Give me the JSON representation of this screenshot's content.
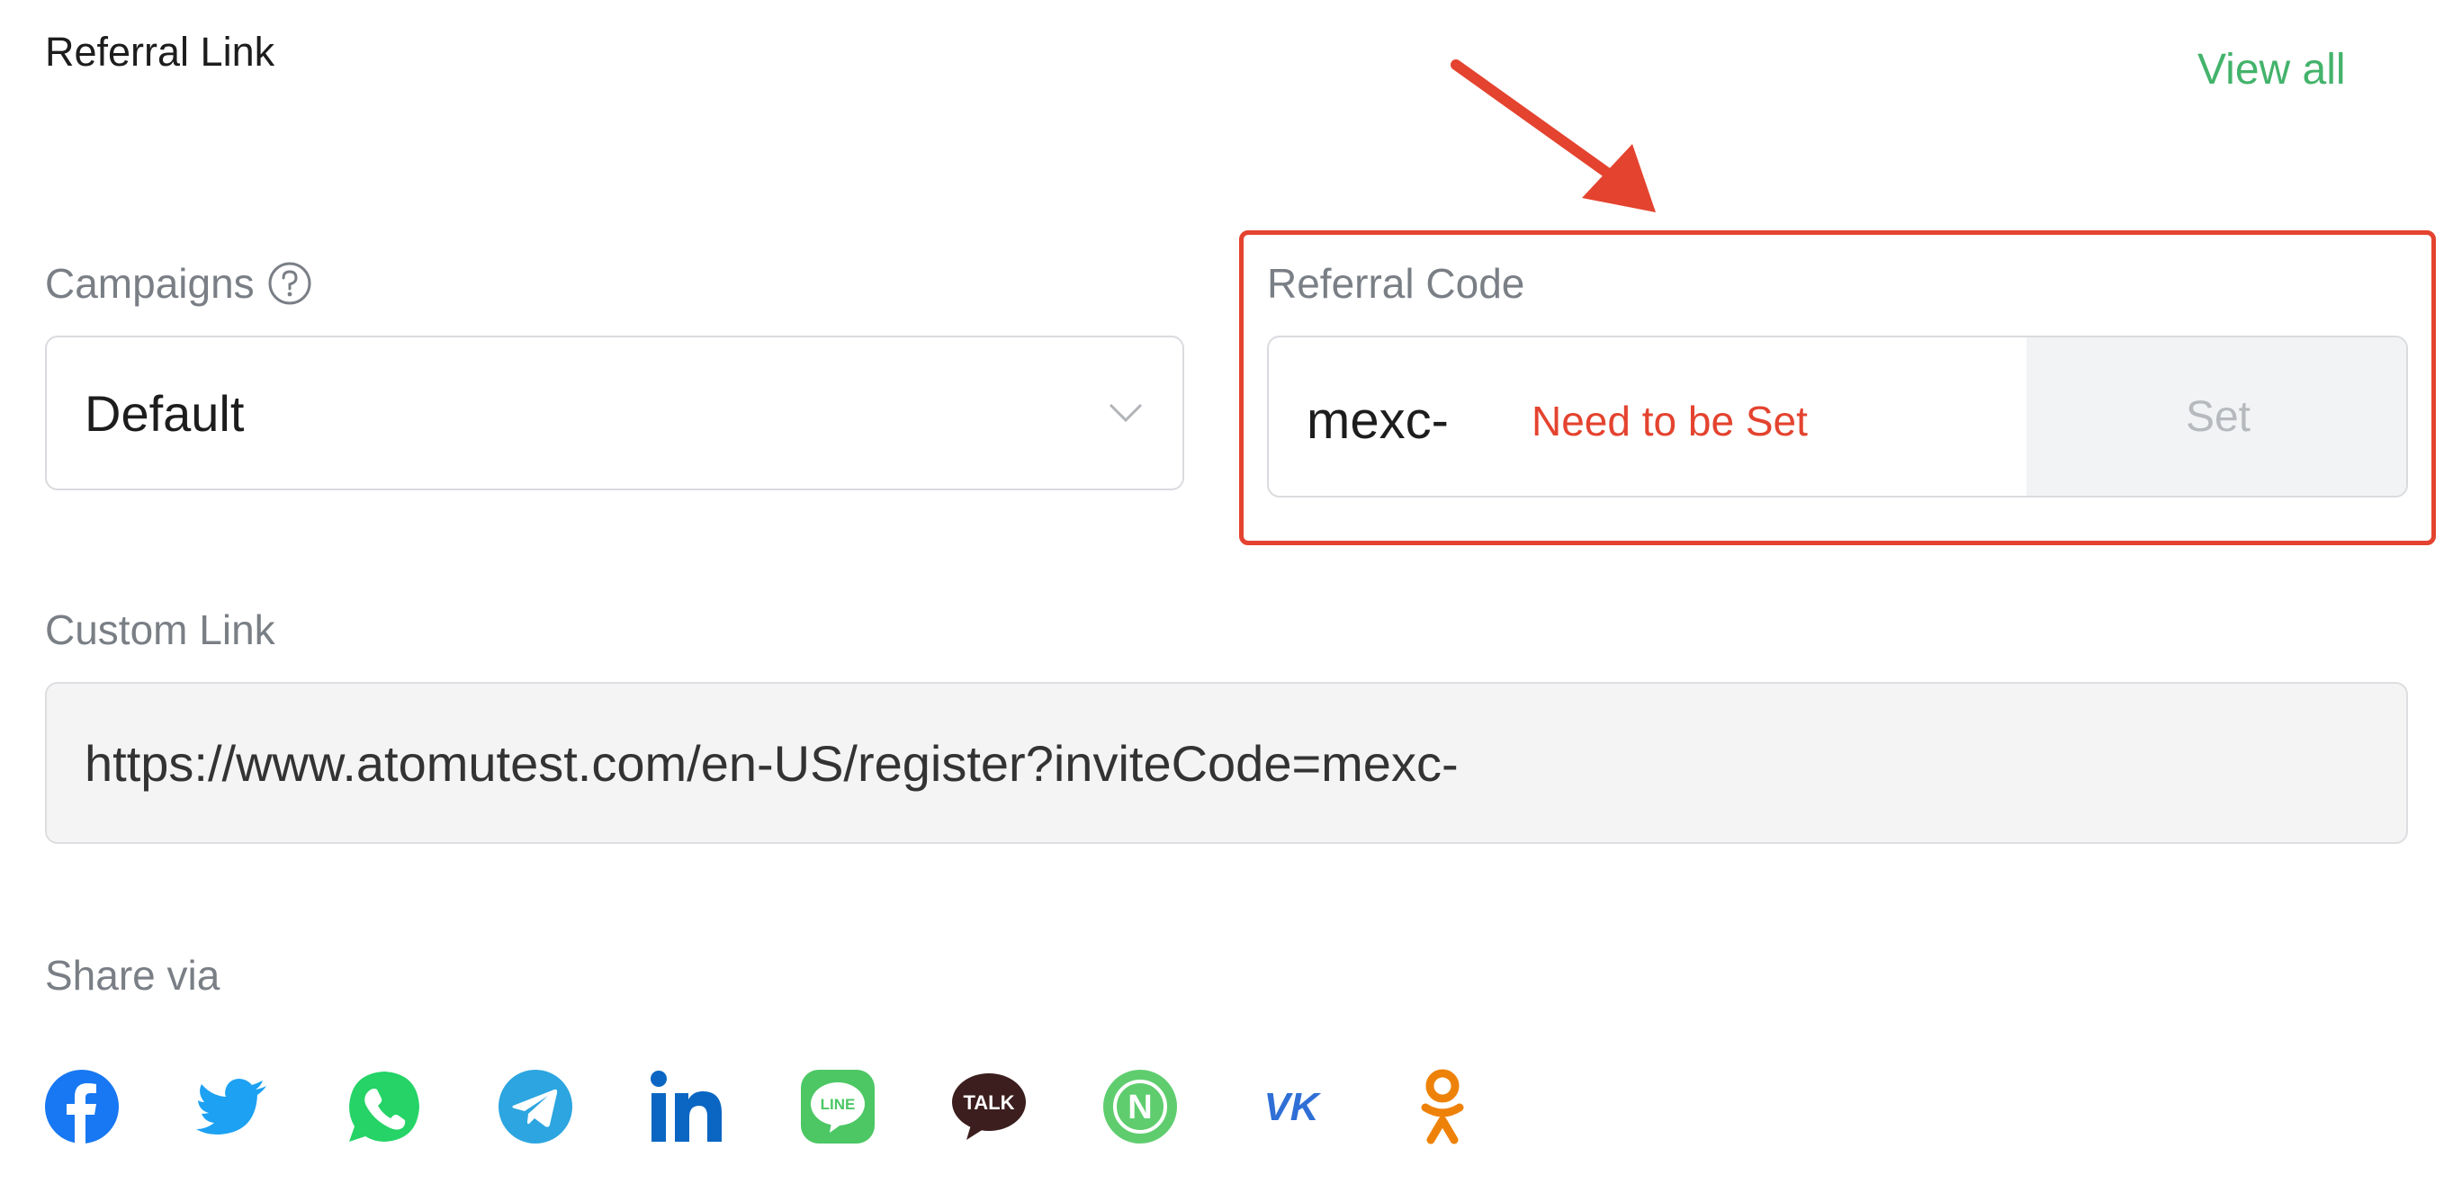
{
  "header": {
    "title": "Referral Link",
    "view_all": "View all"
  },
  "campaigns": {
    "label": "Campaigns",
    "selected": "Default"
  },
  "referral_code": {
    "label": "Referral Code",
    "prefix": "mexc-",
    "annotation": "Need to be Set",
    "set_button": "Set"
  },
  "custom_link": {
    "label": "Custom Link",
    "value": "https://www.atomutest.com/en-US/register?inviteCode=mexc-"
  },
  "share": {
    "label": "Share via",
    "icons": [
      "facebook-icon",
      "twitter-icon",
      "whatsapp-icon",
      "telegram-icon",
      "linkedin-icon",
      "line-icon",
      "kakaotalk-icon",
      "naver-icon",
      "vk-icon",
      "odnoklassniki-icon"
    ],
    "line_text": "LINE",
    "talk_text": "TALK",
    "naver_text": "N",
    "vk_text": "VK"
  },
  "colors": {
    "accent_green": "#43b36b",
    "annotation_red": "#e4432f",
    "facebook": "#1877f2",
    "twitter": "#1da1f2",
    "whatsapp": "#25d366",
    "telegram": "#2ca5e0",
    "linkedin": "#0a66c2",
    "line": "#4cc764",
    "kakaotalk": "#3c1e1e",
    "naver": "#5fcd6e",
    "vk": "#2f6fd6",
    "odnoklassniki": "#ee8208"
  }
}
